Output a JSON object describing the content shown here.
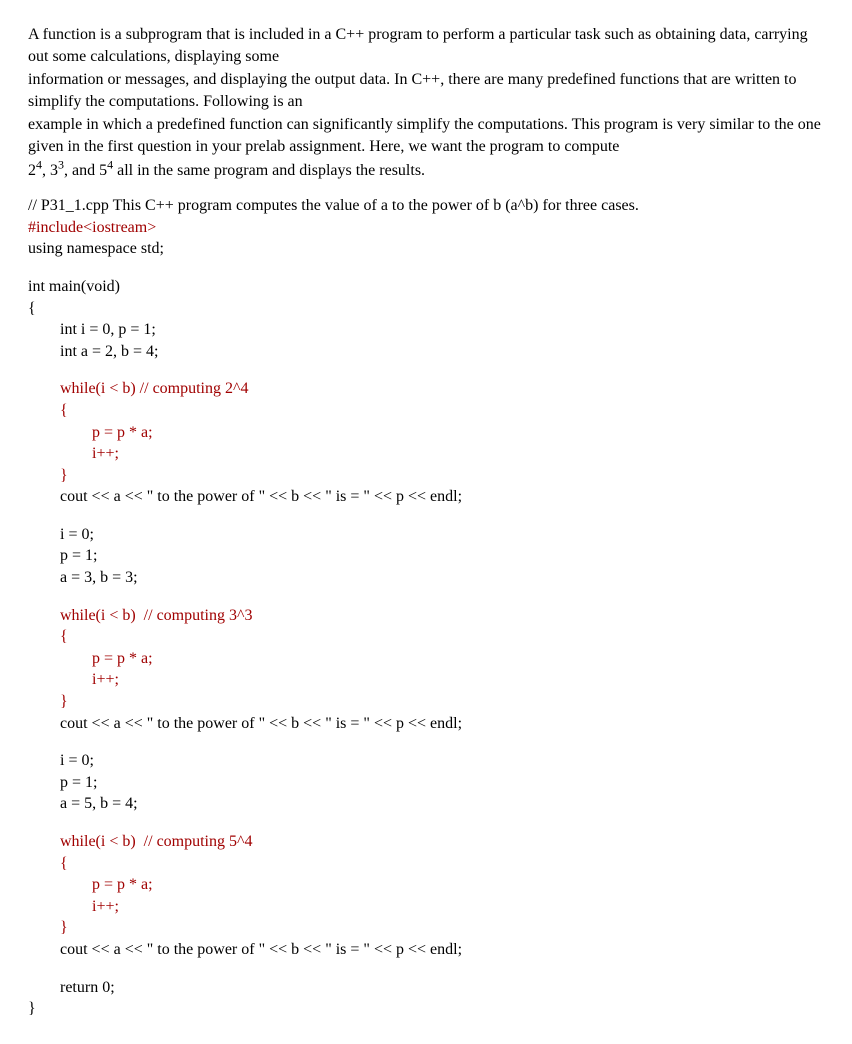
{
  "intro": {
    "p1": "A function is a subprogram that is included in a C++ program to perform a particular task such as obtaining data, carrying out some calculations, displaying some",
    "p2": "information or messages, and displaying the output data.  In C++, there are many predefined functions that are written to simplify the computations.  Following is an",
    "p3": "example in which a predefined function can significantly simplify the computations.  This program is very similar to the one given in the first question in your prelab assignment.  Here, we want the program to compute",
    "p4_a": "2",
    "p4_a_sup": "4",
    "p4_b": ", 3",
    "p4_b_sup": "3",
    "p4_c": ", and 5",
    "p4_c_sup": "4",
    "p4_d": " all in the same program and displays the results."
  },
  "code": {
    "c1": "// P31_1.cpp This C++ program computes the value of a to the power of b (a^b) for three cases.",
    "c2": "#include<iostream>",
    "c3": "using namespace std;",
    "c4": "int main(void)",
    "c5": "{",
    "c6": "int i = 0, p = 1;",
    "c7": "int a = 2, b = 4;",
    "c8": "while(i < b) // computing 2^4",
    "c9": "{",
    "c10": "p = p * a;",
    "c11": "i++;",
    "c12": "}",
    "c13": "cout << a << \" to the power of \" << b << \" is = \" << p << endl;",
    "c14": "i = 0;",
    "c15": "p = 1;",
    "c16": "a = 3, b = 3;",
    "c17": "while(i < b)  // computing 3^3",
    "c18": "{",
    "c19": "p = p * a;",
    "c20": "i++;",
    "c21": "}",
    "c22": "cout << a << \" to the power of \" << b << \" is = \" << p << endl;",
    "c23": "i = 0;",
    "c24": "p = 1;",
    "c25": "a = 5, b = 4;",
    "c26": "while(i < b)  // computing 5^4",
    "c27": "{",
    "c28": "p = p * a;",
    "c29": "i++;",
    "c30": "}",
    "c31": "cout << a << \" to the power of \" << b << \" is = \" << p << endl;",
    "c32": "return 0;",
    "c33": "}"
  }
}
